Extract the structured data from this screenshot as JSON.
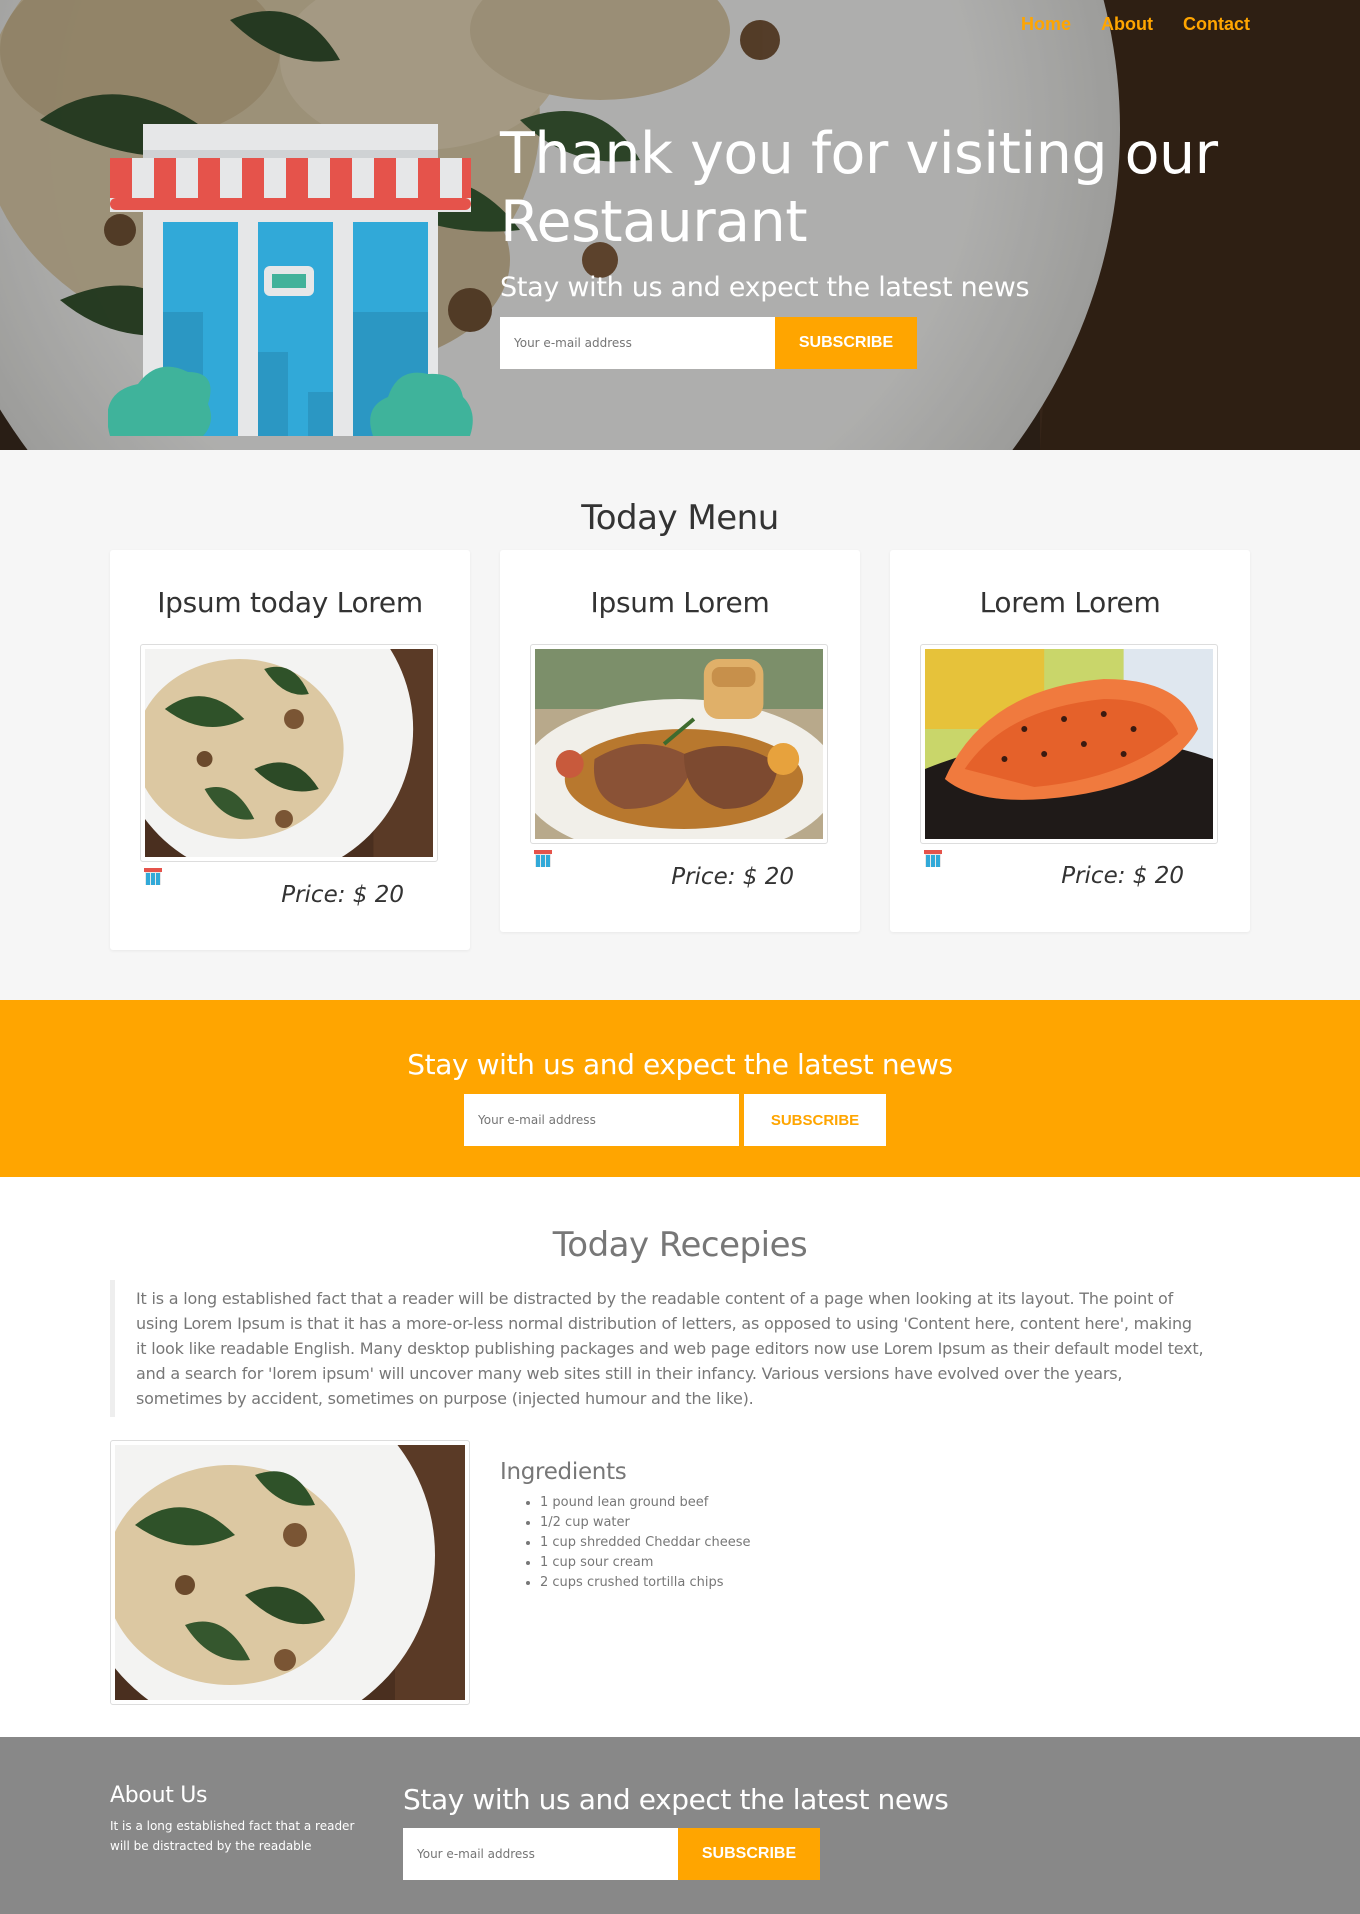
{
  "nav": {
    "items": [
      "Home",
      "About",
      "Contact"
    ]
  },
  "hero": {
    "title": "Thank you for visiting our Restaurant",
    "subtitle": "Stay with us and expect the latest news",
    "email_placeholder": "Your e-mail address",
    "subscribe_label": "SUBSCRIBE"
  },
  "menu": {
    "title": "Today Menu",
    "cards": [
      {
        "title": "Ipsum today Lorem",
        "price": "Price: $ 20"
      },
      {
        "title": "Ipsum Lorem",
        "price": "Price: $ 20"
      },
      {
        "title": "Lorem Lorem",
        "price": "Price: $ 20"
      }
    ]
  },
  "band": {
    "title": "Stay with us and expect the latest news",
    "email_placeholder": "Your e-mail address",
    "subscribe_label": "SUBSCRIBE"
  },
  "recipes": {
    "title": "Today Recepies",
    "quote": "It is a long established fact that a reader will be distracted by the readable content of a page when looking at its layout. The point of using Lorem Ipsum is that it has a more-or-less normal distribution of letters, as opposed to using 'Content here, content here', making it look like readable English. Many desktop publishing packages and web page editors now use Lorem Ipsum as their default model text, and a search for 'lorem ipsum' will uncover many web sites still in their infancy. Various versions have evolved over the years, sometimes by accident, sometimes on purpose (injected humour and the like).",
    "ingredients_title": "Ingredients",
    "ingredients": [
      "1 pound lean ground beef",
      "1/2 cup water",
      "1 cup shredded Cheddar cheese",
      "1 cup sour cream",
      "2 cups crushed tortilla chips"
    ]
  },
  "footer": {
    "about_title": "About Us",
    "about_text": "It is a long established fact that a reader will be distracted by the readable",
    "news_title": "Stay with us and expect the latest news",
    "email_placeholder": "Your e-mail address",
    "subscribe_label": "SUBSCRIBE"
  },
  "colors": {
    "accent": "#ffa500",
    "footer_bg": "#888888",
    "section_bg": "#f6f6f6"
  },
  "icons": [
    "shop-icon",
    "pasta-photo",
    "steak-photo",
    "salmon-photo",
    "shop-mini-icon"
  ]
}
